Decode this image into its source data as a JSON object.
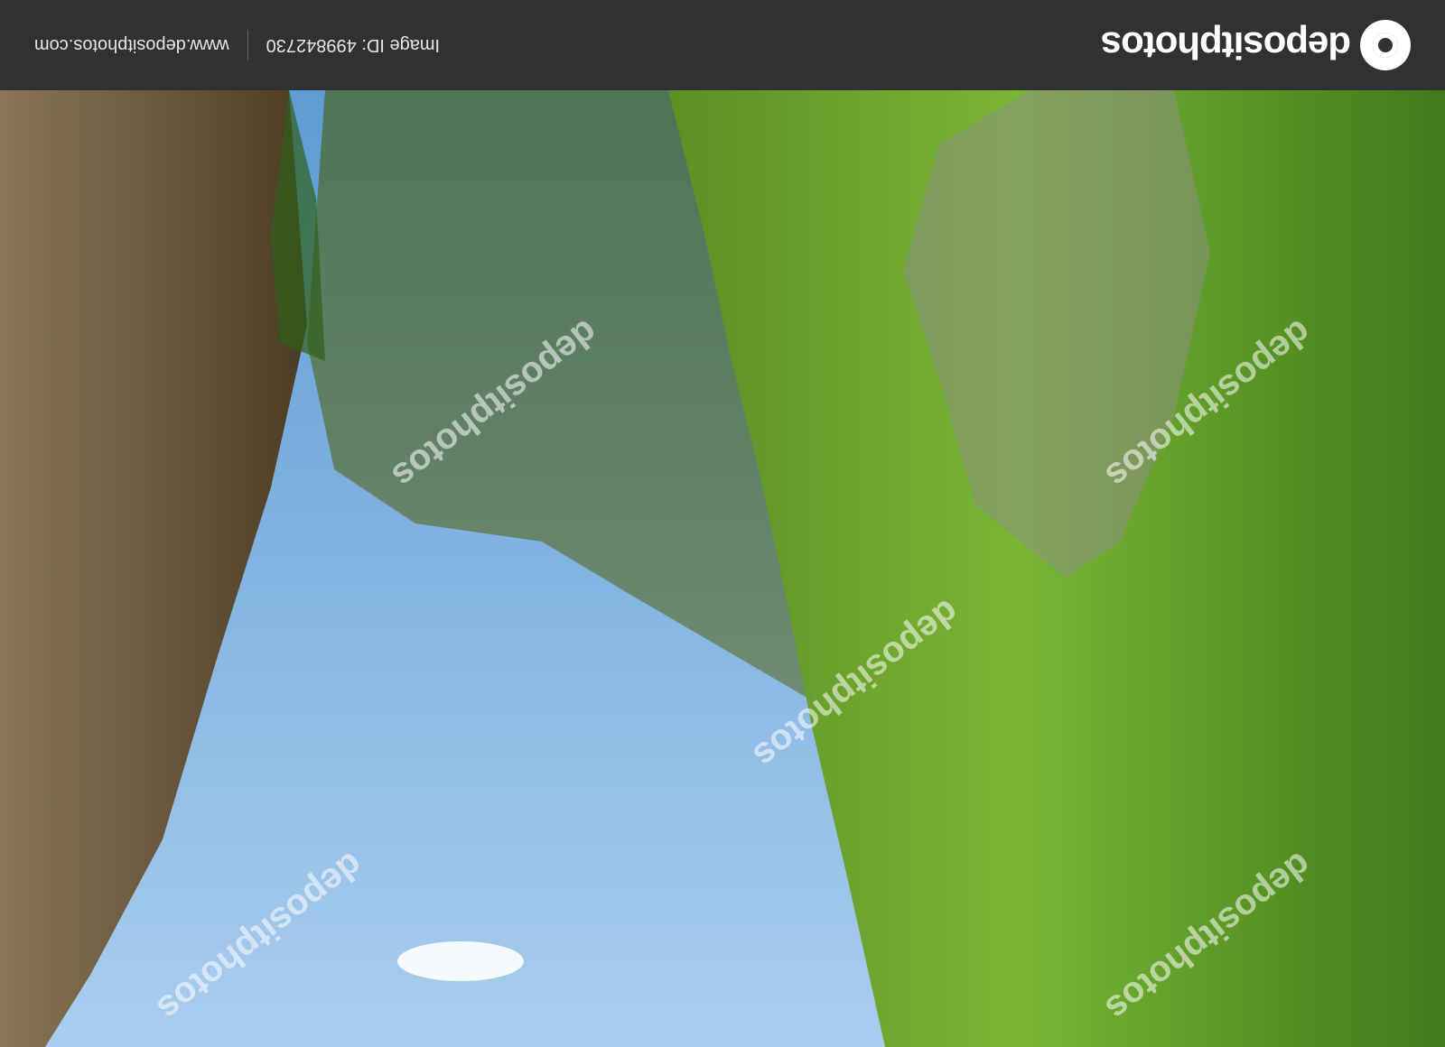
{
  "footer": {
    "brand": "depositphotos",
    "image_id": "Image ID: 499842730",
    "url": "www.depositphotos.com"
  },
  "watermark": {
    "text": "depositphotos"
  },
  "colors": {
    "sky": "#7fb2e0",
    "cliff_green": "#6aa32a",
    "rock": "#7d6f55",
    "bar": "#303133"
  }
}
